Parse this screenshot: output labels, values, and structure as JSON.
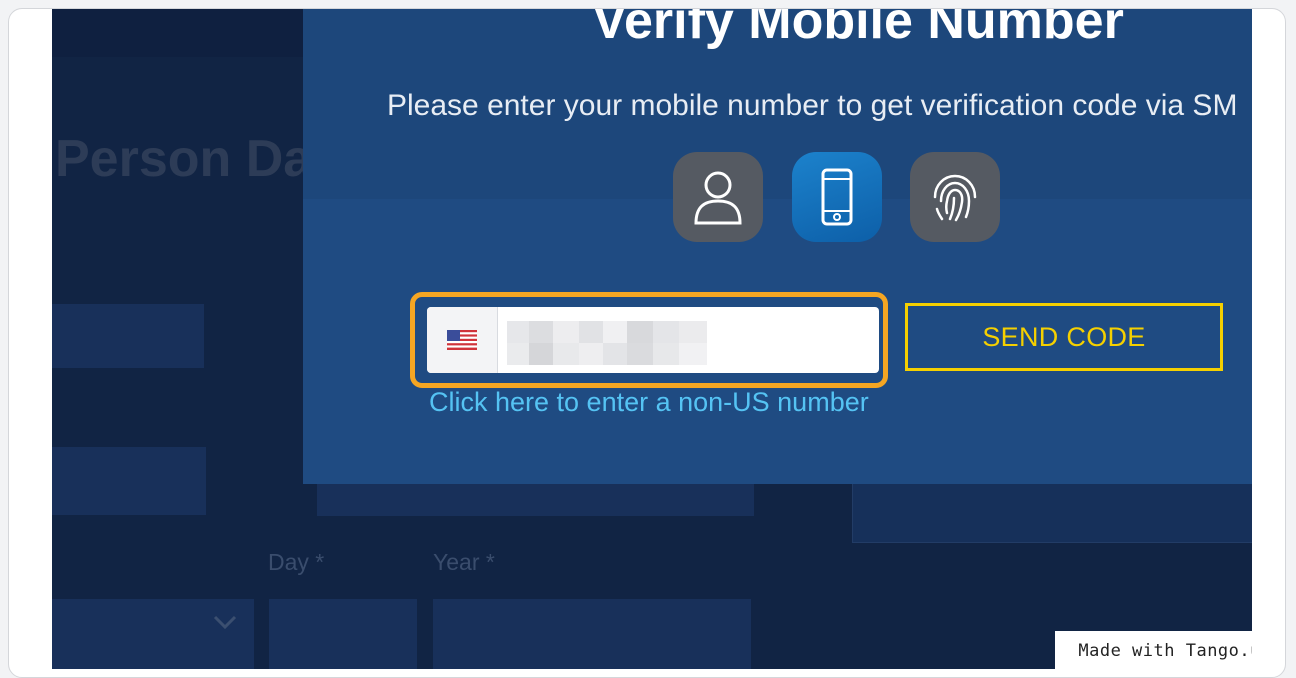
{
  "background_page": {
    "title_fragment": "Person Da",
    "day_label": "Day *",
    "year_label": "Year *"
  },
  "modal": {
    "title": "Verify Mobile Number",
    "subtitle": "Please enter your mobile number to get verification code via SM",
    "steps": [
      {
        "icon": "person-icon",
        "state": "inactive"
      },
      {
        "icon": "phone-icon",
        "state": "active"
      },
      {
        "icon": "fingerprint-icon",
        "state": "inactive"
      }
    ],
    "phone_field": {
      "country_flag": "us-flag-icon",
      "value": "",
      "masked": true
    },
    "send_code_label": "SEND CODE",
    "non_us_link": "Click here to enter a non-US number"
  },
  "watermark": "Made with Tango.us",
  "colors": {
    "highlight": "#f5a623",
    "send_button": "#f5d000",
    "link": "#55c3f3",
    "modal_bg": "#1f4b82"
  }
}
